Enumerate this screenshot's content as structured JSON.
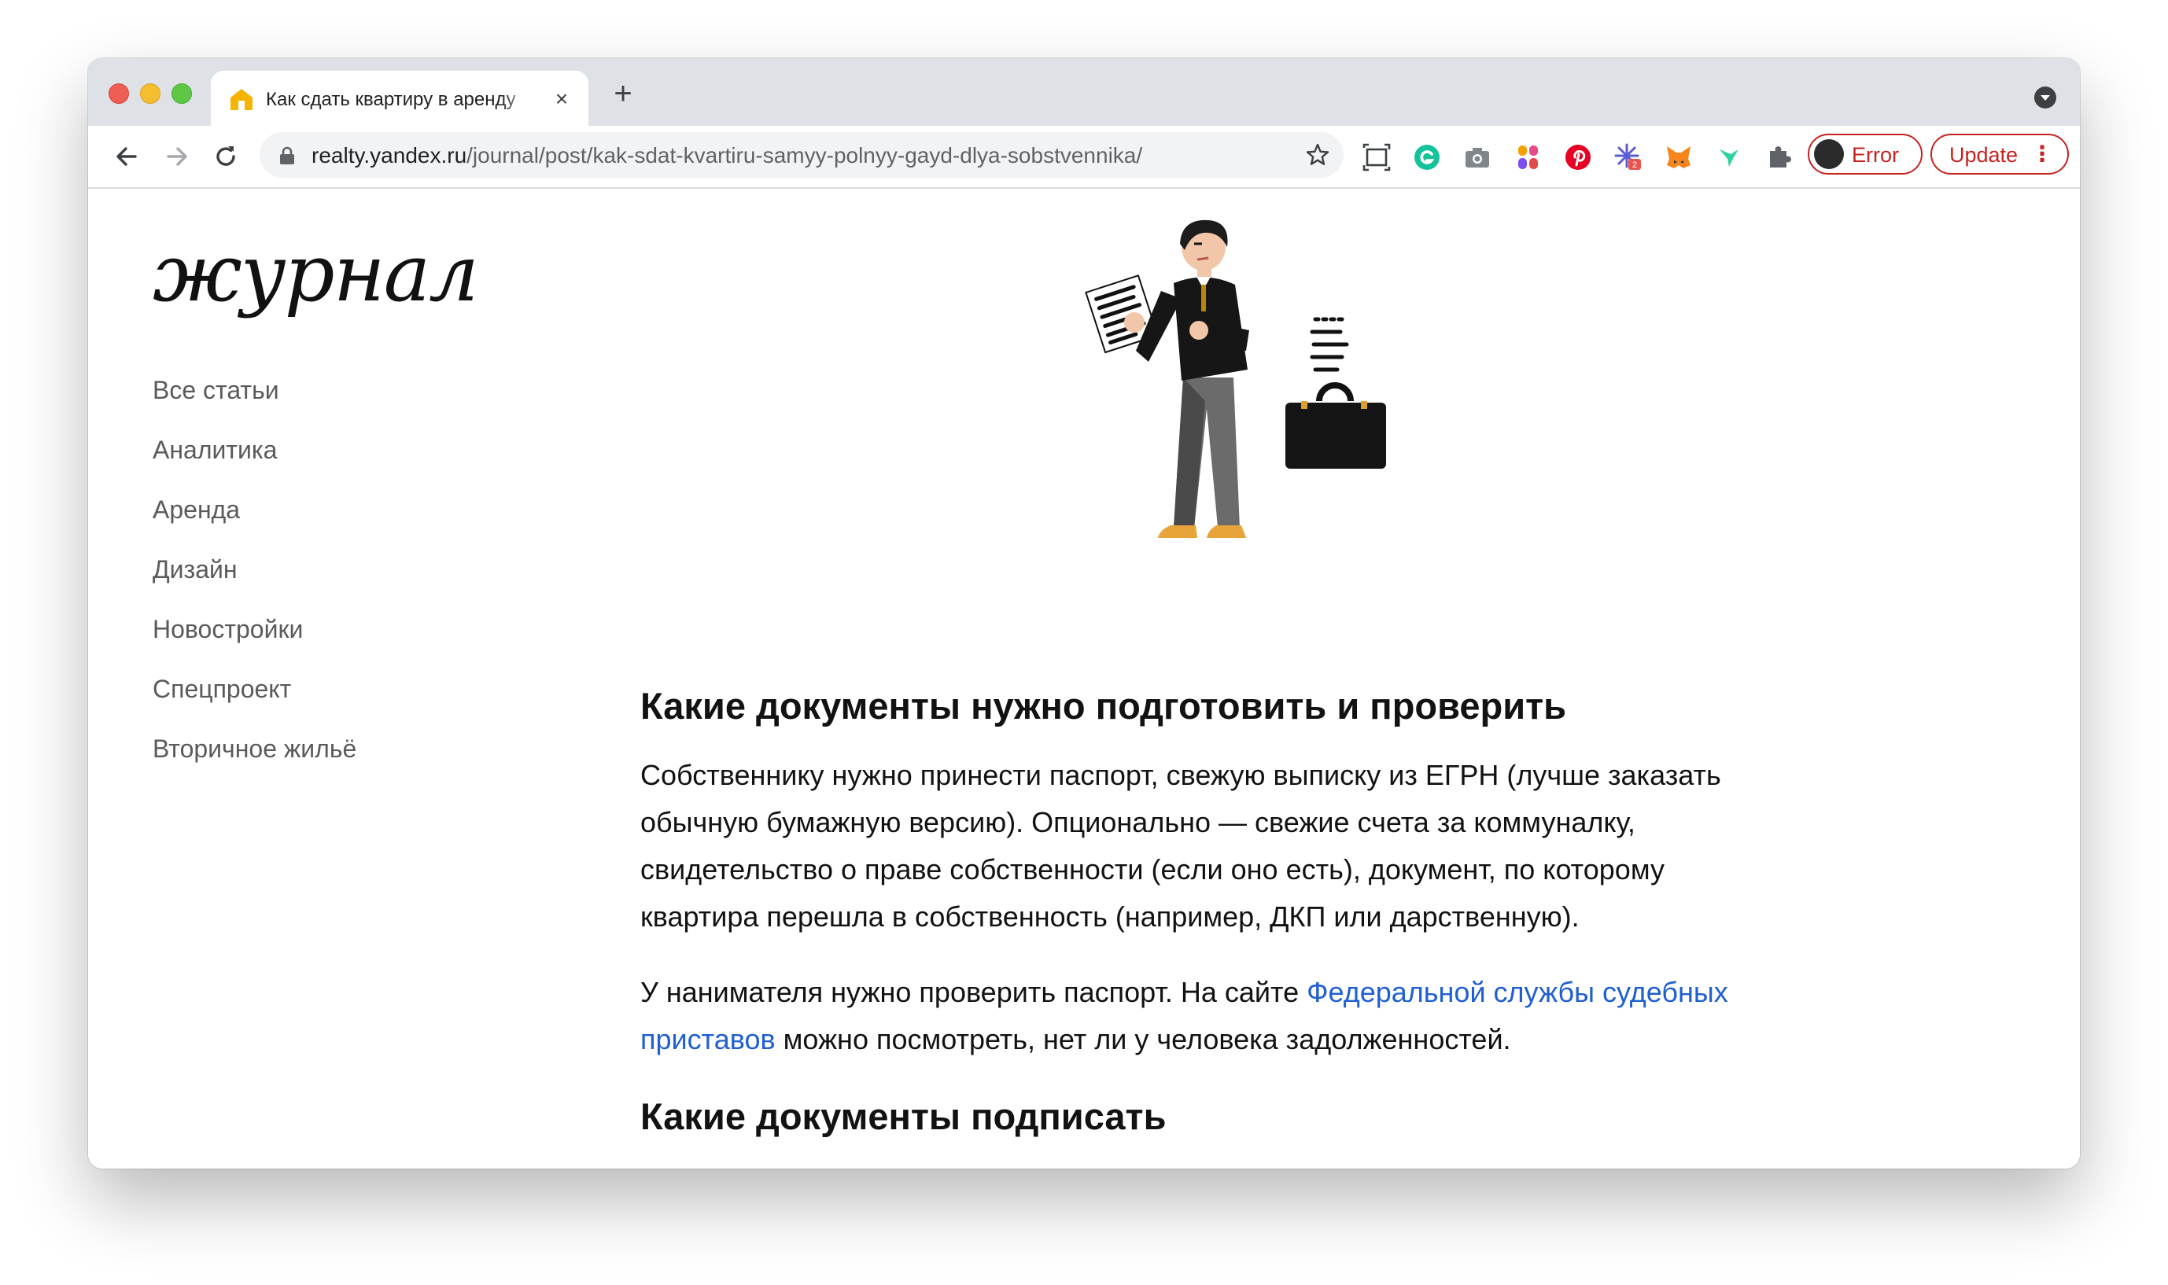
{
  "browser": {
    "tab_title": "Как сдать квартиру в аренду",
    "new_tab_icon": "plus-icon",
    "url_host": "realty.yandex.ru",
    "url_path": "/journal/post/kak-sdat-kvartiru-samyy-polnyy-gayd-dlya-sobstvennika/",
    "extension_badge": "2",
    "error_label": "Error",
    "update_label": "Update",
    "accent_error": "#c5221f"
  },
  "site": {
    "logo_text": "журнал",
    "nav": [
      "Все статьи",
      "Аналитика",
      "Аренда",
      "Дизайн",
      "Новостройки",
      "Спецпроект",
      "Вторичное жильё"
    ]
  },
  "article": {
    "heading1": "Какие документы нужно подготовить и проверить",
    "para1": "Собственнику нужно принести паспорт, свежую выписку из ЕГРН (лучше заказать обычную бумажную версию). Опционально — свежие счета за коммуналку, свидетельство о праве собственности (если оно есть), документ, по которому квартира перешла в собственность (например, ДКП или дарственную).",
    "para2_before": "У нанимателя нужно проверить паспорт. На сайте ",
    "para2_link": "Федеральной службы судебных приставов",
    "para2_after": " можно посмотреть, нет ли у человека задолженностей.",
    "heading2": "Какие документы подписать",
    "link_color": "#1f5fd1"
  }
}
